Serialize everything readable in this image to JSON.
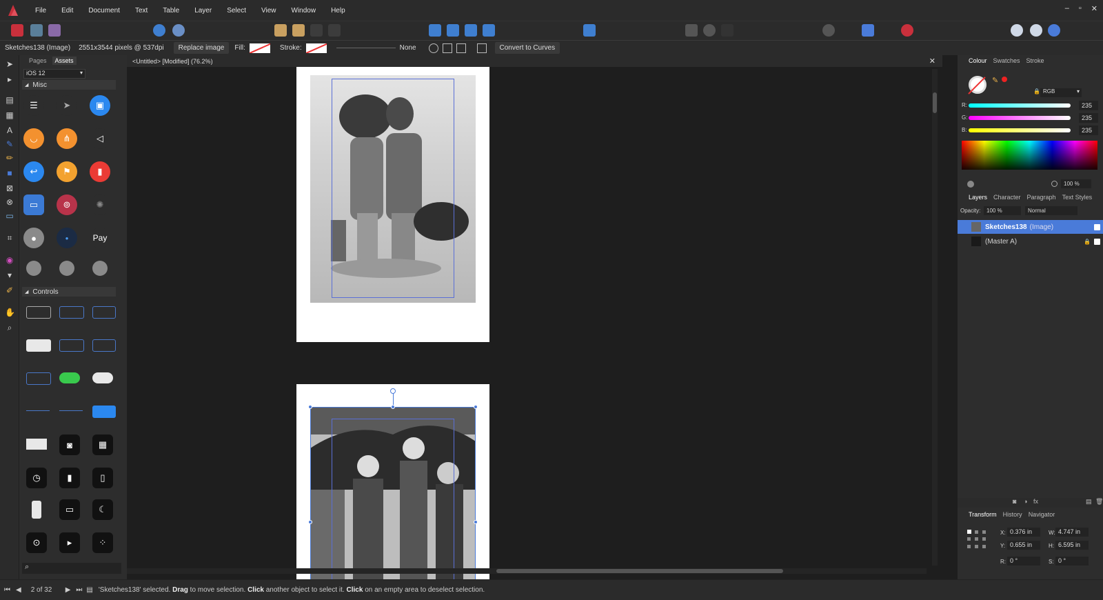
{
  "menu": [
    "File",
    "Edit",
    "Document",
    "Text",
    "Table",
    "Layer",
    "Select",
    "View",
    "Window",
    "Help"
  ],
  "window_controls": [
    "–",
    "▫",
    "✕"
  ],
  "context": {
    "object_name": "Sketches138 (Image)",
    "pixel_info": "2551x3544 pixels @ 537dpi",
    "replace_label": "Replace image",
    "fill_label": "Fill:",
    "stroke_label": "Stroke:",
    "stroke_style_label": "None",
    "convert_label": "Convert to Curves"
  },
  "assets_panel": {
    "tabs": [
      "Pages",
      "Assets"
    ],
    "active_tab": "Assets",
    "category": "iOS 12",
    "sections": [
      "Misc",
      "Controls"
    ]
  },
  "document": {
    "tab_title": "<Untitled> [Modified] (76.2%)"
  },
  "colour_panel": {
    "tabs": [
      "Colour",
      "Swatches",
      "Stroke"
    ],
    "model": "RGB",
    "r_label": "R:",
    "g_label": "G:",
    "b_label": "B:",
    "r": "235",
    "g": "235",
    "b": "235",
    "opacity": "100 %"
  },
  "layers_panel": {
    "tabs": [
      "Layers",
      "Character",
      "Paragraph",
      "Text Styles"
    ],
    "opacity_label": "Opacity:",
    "opacity": "100 %",
    "blend_mode": "Normal",
    "layers": [
      {
        "name": "Sketches138",
        "suffix": "(Image)"
      },
      {
        "name": "(Master A)",
        "suffix": ""
      }
    ]
  },
  "transform_panel": {
    "tabs": [
      "Transform",
      "History",
      "Navigator"
    ],
    "x_label": "X:",
    "x": "0.376 in",
    "y_label": "Y:",
    "y": "0.655 in",
    "w_label": "W:",
    "w": "4.747 in",
    "h_label": "H:",
    "h": "6.595 in",
    "r_label": "R:",
    "r": "0 °",
    "s_label": "S:",
    "s": "0 °"
  },
  "status": {
    "page_counter": "2 of 32",
    "message_prefix": "'Sketches138' selected.",
    "drag": "Drag",
    "drag_text": "to move selection.",
    "click": "Click",
    "click_text": "another object to select it.",
    "click2": "Click",
    "click2_text": "on an empty area to deselect selection."
  },
  "colors": {
    "accent": "#4a7bd9",
    "selection_row": "#4a7bd9",
    "background": "#1e1e1e",
    "panel": "#2d2d2d"
  }
}
